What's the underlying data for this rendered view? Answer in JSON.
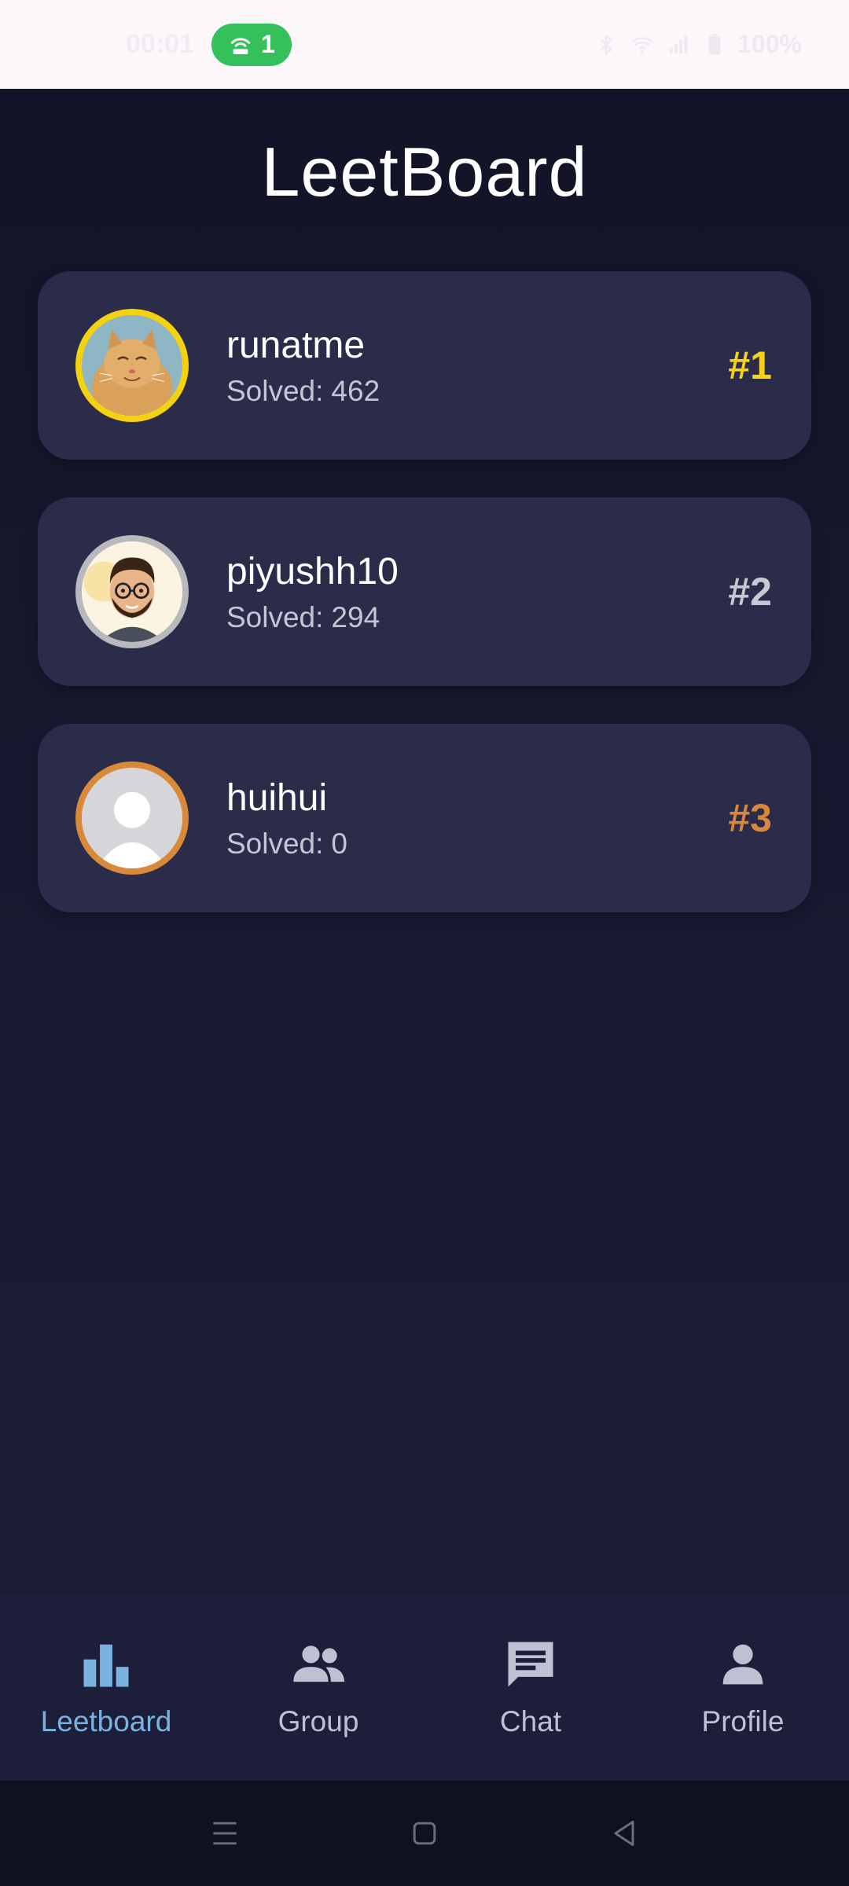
{
  "status_bar": {
    "time": "00:01",
    "hotspot_count": "1",
    "battery": "100%"
  },
  "app": {
    "title": "LeetBoard"
  },
  "leaderboard": {
    "solved_label": "Solved:",
    "entries": [
      {
        "username": "runatme",
        "solved": "462",
        "rank": "#1",
        "avatar": "cat-avatar",
        "ring_color": "#f5d211"
      },
      {
        "username": "piyushh10",
        "solved": "294",
        "rank": "#2",
        "avatar": "cartoon-man-avatar",
        "ring_color": "#b9b9bd"
      },
      {
        "username": "huihui",
        "solved": "0",
        "rank": "#3",
        "avatar": "default-person-avatar",
        "ring_color": "#d88a3a"
      }
    ]
  },
  "bottom_nav": {
    "items": [
      {
        "label": "Leetboard",
        "icon": "bar-chart-icon",
        "active": true
      },
      {
        "label": "Group",
        "icon": "group-icon",
        "active": false
      },
      {
        "label": "Chat",
        "icon": "chat-icon",
        "active": false
      },
      {
        "label": "Profile",
        "icon": "person-icon",
        "active": false
      }
    ]
  },
  "colors": {
    "active_nav": "#7ab3df",
    "inactive_nav": "#bfc1d3",
    "gold": "#f6d216",
    "silver": "#c7c8d2",
    "bronze": "#d8873c"
  }
}
